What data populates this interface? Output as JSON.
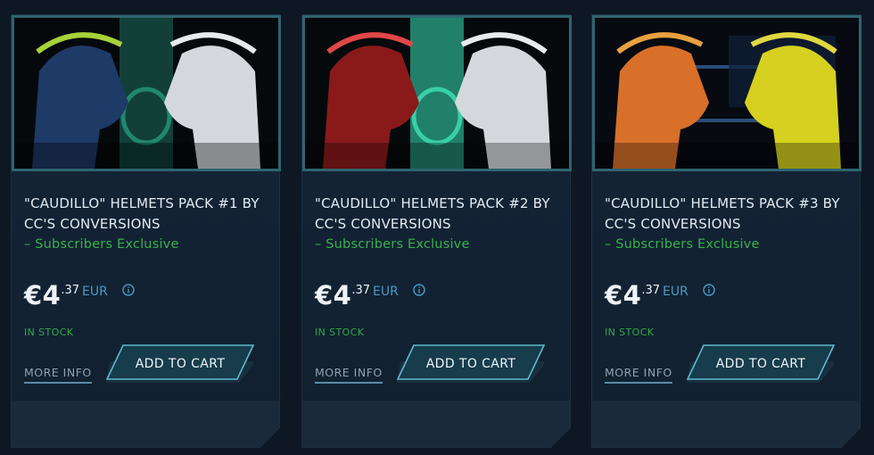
{
  "products": [
    {
      "title": "\"CAUDILLO\" HELMETS PACK #1 BY CC'S CONVERSIONS",
      "subtitle": "– Subscribers Exclusive",
      "price_main": "€4",
      "price_cents": ".37",
      "currency": "EUR",
      "stock": "IN STOCK",
      "more_info": "MORE INFO",
      "cart": "ADD TO CART",
      "helmet_left": "#1e3a66",
      "helmet_right": "#d4d8dc",
      "glow": "#3fe0b0",
      "visor_left": "#a6d23a"
    },
    {
      "title": "\"CAUDILLO\" HELMETS PACK #2 BY CC'S CONVERSIONS",
      "subtitle": "– Subscribers Exclusive",
      "price_main": "€4",
      "price_cents": ".37",
      "currency": "EUR",
      "stock": "IN STOCK",
      "more_info": "MORE INFO",
      "cart": "ADD TO CART",
      "helmet_left": "#8a1a1a",
      "helmet_right": "#d4d8dc",
      "glow": "#46f0c0",
      "visor_left": "#e04848"
    },
    {
      "title": "\"CAUDILLO\" HELMETS PACK #3 BY CC'S CONVERSIONS",
      "subtitle": "– Subscribers Exclusive",
      "price_main": "€4",
      "price_cents": ".37",
      "currency": "EUR",
      "stock": "IN STOCK",
      "more_info": "MORE INFO",
      "cart": "ADD TO CART",
      "helmet_left": "#d8702a",
      "helmet_right": "#d6d020",
      "glow": "#3a6aa8",
      "visor_left": "#e8a040"
    }
  ],
  "colors": {
    "accent": "#4a9ac6",
    "green": "#33a847",
    "border": "#2f6470",
    "cart_bg": "#173c4c",
    "cart_border": "#5fb9cc"
  },
  "icons": {
    "info": "info-circle-icon"
  }
}
